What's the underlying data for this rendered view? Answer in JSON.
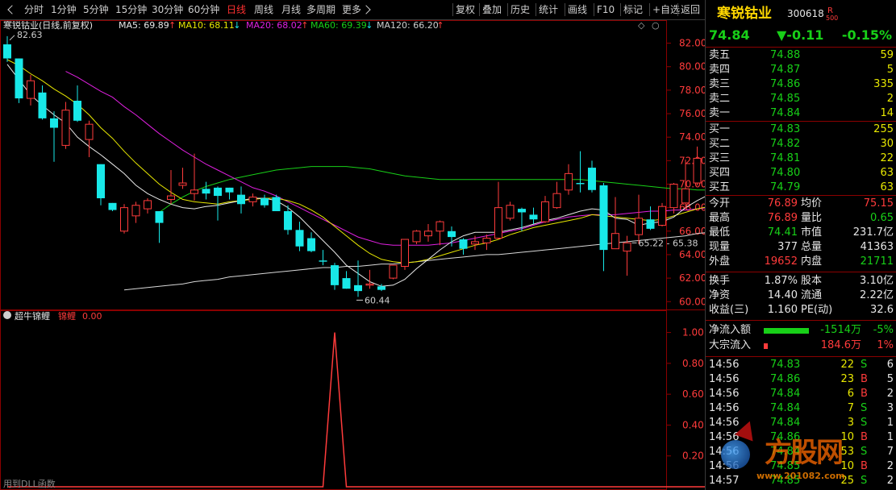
{
  "toolbar": {
    "left": [
      "分时",
      "1分钟",
      "5分钟",
      "15分钟",
      "30分钟",
      "60分钟",
      "日线",
      "周线",
      "月线",
      "多周期",
      "更多"
    ],
    "active": "日线",
    "right": [
      "复权",
      "叠加",
      "历史",
      "统计",
      "画线",
      "F10",
      "标记",
      "+自选",
      "返回"
    ]
  },
  "main": {
    "title": "寒锐钴业(日线,前复权)",
    "ma": [
      {
        "label": "MA5: 69.89",
        "arrow": "↑",
        "arrow_color": "#ff3b3b",
        "color": "#e8e8e8"
      },
      {
        "label": "MA10: 68.11",
        "arrow": "↓",
        "arrow_color": "#18e8e8",
        "color": "#e8e800"
      },
      {
        "label": "MA20: 68.02",
        "arrow": "↑",
        "arrow_color": "#ff3b3b",
        "color": "#e020e0"
      },
      {
        "label": "MA60: 69.39",
        "arrow": "↓",
        "arrow_color": "#18e8e8",
        "color": "#18d018"
      },
      {
        "label": "MA120: 66.20",
        "arrow": "↑",
        "arrow_color": "#ff3b3b",
        "color": "#cfcfcf"
      }
    ],
    "high_note": "82.63",
    "low_note": "60.44",
    "range_note": "65.22 - 65.38",
    "controls": [
      "◇",
      "○"
    ]
  },
  "sub": {
    "title": "超牛锦鲤",
    "series_label": "锦鲤",
    "value": "0.00",
    "footer": "用到DLL函数"
  },
  "chart_data": {
    "type": "candlestick",
    "ylim": [
      59.4,
      83.0
    ],
    "yticks": [
      "82.00",
      "80.00",
      "78.00",
      "76.00",
      "74.00",
      "72.00",
      "70.00",
      "68.00",
      "66.00",
      "64.00",
      "62.00",
      "60.00"
    ],
    "candles": [
      [
        81.9,
        82.6,
        80.4,
        80.7
      ],
      [
        80.7,
        80.7,
        76.9,
        77.3
      ],
      [
        77.3,
        79.3,
        76.7,
        78.8
      ],
      [
        77.8,
        78.4,
        75.5,
        75.6
      ],
      [
        75.6,
        76.2,
        71.9,
        74.8
      ],
      [
        73.3,
        77.0,
        73.0,
        76.3
      ],
      [
        77.1,
        78.4,
        75.3,
        75.4
      ],
      [
        73.8,
        75.4,
        72.3,
        75.1
      ],
      [
        71.7,
        71.7,
        68.2,
        68.8
      ],
      [
        68.4,
        68.4,
        67.7,
        67.8
      ],
      [
        66.0,
        68.3,
        65.8,
        68.0
      ],
      [
        67.3,
        68.5,
        66.7,
        68.2
      ],
      [
        67.9,
        68.8,
        67.5,
        68.6
      ],
      [
        67.7,
        67.7,
        65.0,
        66.7
      ],
      [
        68.7,
        71.2,
        68.3,
        69.0
      ],
      [
        69.9,
        71.4,
        69.6,
        70.1
      ],
      [
        69.2,
        72.6,
        68.6,
        69.5
      ],
      [
        69.6,
        70.2,
        68.7,
        69.2
      ],
      [
        69.7,
        69.8,
        66.9,
        69.0
      ],
      [
        69.7,
        69.7,
        68.7,
        69.3
      ],
      [
        69.1,
        69.8,
        67.5,
        68.3
      ],
      [
        68.5,
        69.2,
        68.1,
        68.9
      ],
      [
        68.8,
        69.1,
        68.0,
        68.2
      ],
      [
        68.9,
        69.1,
        67.7,
        67.7
      ],
      [
        67.7,
        68.2,
        65.7,
        66.1
      ],
      [
        66.1,
        66.8,
        64.3,
        64.7
      ],
      [
        65.4,
        65.9,
        64.2,
        64.3
      ],
      [
        63.5,
        64.4,
        63.1,
        63.4
      ],
      [
        63.1,
        63.3,
        61.0,
        61.4
      ],
      [
        62.0,
        62.6,
        61.1,
        61.1
      ],
      [
        61.4,
        63.5,
        60.4,
        60.9
      ],
      [
        61.4,
        62.7,
        61.1,
        61.5
      ],
      [
        61.3,
        61.5,
        60.9,
        61.0
      ],
      [
        62.0,
        63.1,
        61.9,
        63.1
      ],
      [
        63.0,
        65.3,
        62.7,
        65.3
      ],
      [
        65.1,
        66.1,
        64.9,
        66.0
      ],
      [
        65.6,
        66.6,
        65.1,
        66.0
      ],
      [
        66.0,
        66.9,
        64.8,
        66.8
      ],
      [
        66.0,
        66.4,
        64.7,
        65.5
      ],
      [
        65.3,
        65.4,
        64.0,
        64.5
      ],
      [
        64.9,
        65.6,
        64.4,
        65.1
      ],
      [
        65.0,
        65.7,
        64.4,
        65.4
      ],
      [
        65.4,
        70.2,
        65.3,
        68.0
      ],
      [
        67.1,
        68.5,
        66.9,
        68.2
      ],
      [
        67.9,
        68.0,
        66.0,
        67.6
      ],
      [
        67.4,
        68.0,
        66.6,
        67.0
      ],
      [
        66.8,
        69.0,
        66.7,
        68.5
      ],
      [
        68.0,
        70.2,
        67.9,
        69.2
      ],
      [
        69.5,
        71.7,
        69.1,
        70.9
      ],
      [
        70.1,
        72.8,
        69.3,
        70.0
      ],
      [
        71.4,
        72.0,
        69.3,
        69.5
      ],
      [
        69.9,
        70.1,
        62.6,
        64.4
      ],
      [
        64.5,
        68.9,
        65.4,
        65.8
      ],
      [
        64.3,
        65.6,
        62.2,
        65.0
      ],
      [
        65.7,
        69.1,
        64.9,
        67.1
      ],
      [
        67.0,
        68.1,
        66.1,
        66.2
      ],
      [
        66.5,
        68.4,
        66.4,
        68.1
      ],
      [
        68.0,
        70.1,
        67.5,
        70.0
      ],
      [
        68.4,
        72.1,
        67.9,
        69.6
      ],
      [
        70.1,
        73.2,
        69.9,
        72.2
      ],
      [
        71.1,
        71.7,
        68.2,
        69.5
      ],
      [
        69.8,
        71.5,
        68.3,
        71.2
      ],
      [
        69.5,
        70.2,
        67.9,
        68.1
      ],
      [
        68.2,
        72.3,
        67.9,
        70.5
      ]
    ],
    "ma5": [
      80.2,
      78.9,
      77.6,
      76.7,
      75.9,
      75.2,
      74.0,
      73.2,
      72.5,
      71.7,
      70.9,
      69.9,
      69.2,
      68.7,
      68.3,
      68.0,
      67.9,
      68.1,
      68.2,
      68.4,
      68.6,
      68.8,
      68.8,
      68.6,
      68.0,
      67.2,
      66.2,
      65.2,
      64.2,
      63.1,
      62.4,
      61.7,
      61.3,
      61.4,
      61.9,
      62.8,
      63.6,
      64.4,
      65.1,
      65.6,
      65.9,
      65.9,
      65.9,
      66.1,
      66.3,
      66.6,
      66.9,
      67.1,
      67.4,
      67.7,
      67.9,
      67.8,
      67.1,
      67.0,
      66.5,
      66.7,
      66.8,
      67.2,
      68.0,
      68.6,
      69.1,
      69.3,
      69.6,
      69.9
    ],
    "ma10": [
      80.6,
      80.1,
      79.4,
      78.8,
      78.1,
      77.5,
      76.8,
      75.9,
      74.8,
      73.9,
      72.8,
      71.8,
      70.9,
      70.0,
      69.3,
      68.7,
      68.5,
      68.4,
      68.3,
      68.5,
      68.6,
      68.7,
      68.8,
      68.8,
      68.6,
      68.3,
      67.8,
      67.2,
      66.4,
      65.6,
      64.8,
      64.1,
      63.6,
      63.4,
      63.3,
      63.4,
      63.6,
      63.9,
      64.2,
      64.5,
      64.8,
      65.0,
      65.3,
      65.7,
      66.0,
      66.3,
      66.5,
      66.7,
      66.9,
      67.1,
      67.4,
      67.3,
      67.2,
      67.1,
      67.0,
      66.9,
      67.0,
      67.3,
      67.6,
      67.9,
      68.1,
      68.3,
      68.1,
      68.1
    ],
    "ma20": [
      null,
      null,
      null,
      null,
      null,
      79.6,
      79.1,
      78.5,
      77.9,
      77.4,
      76.6,
      75.9,
      75.1,
      74.3,
      73.6,
      72.9,
      72.3,
      71.7,
      71.2,
      70.7,
      70.2,
      69.7,
      69.4,
      69.0,
      68.5,
      68.0,
      67.5,
      67.0,
      66.5,
      66.0,
      65.5,
      65.2,
      64.9,
      64.8,
      64.8,
      64.8,
      64.8,
      64.9,
      65.0,
      65.2,
      65.4,
      65.6,
      65.8,
      66.0,
      66.2,
      66.5,
      66.8,
      67.0,
      67.2,
      67.3,
      67.4,
      67.4,
      67.4,
      67.5,
      67.6,
      67.7,
      67.7,
      67.8,
      67.8,
      67.9,
      68.0,
      68.0,
      68.0,
      68.02
    ],
    "ma60": [
      null,
      null,
      null,
      null,
      null,
      null,
      null,
      null,
      null,
      null,
      null,
      null,
      null,
      67.6,
      68.3,
      68.9,
      69.4,
      69.8,
      70.1,
      70.4,
      70.6,
      70.8,
      71.0,
      71.2,
      71.3,
      71.4,
      71.5,
      71.5,
      71.5,
      71.5,
      71.4,
      71.3,
      71.1,
      70.9,
      70.7,
      70.6,
      70.5,
      70.4,
      70.4,
      70.4,
      70.4,
      70.4,
      70.4,
      70.4,
      70.4,
      70.4,
      70.4,
      70.4,
      70.4,
      70.4,
      70.3,
      70.2,
      70.1,
      70.0,
      69.9,
      69.8,
      69.7,
      69.6,
      69.6,
      69.5,
      69.5,
      69.4,
      69.4,
      69.39
    ],
    "ma120": [
      null,
      null,
      null,
      null,
      null,
      null,
      null,
      null,
      null,
      null,
      61.0,
      61.1,
      61.2,
      61.3,
      61.4,
      61.5,
      61.7,
      61.8,
      61.9,
      62.1,
      62.2,
      62.3,
      62.4,
      62.5,
      62.6,
      62.7,
      62.8,
      62.9,
      62.9,
      63.0,
      63.0,
      63.1,
      63.2,
      63.2,
      63.3,
      63.4,
      63.5,
      63.6,
      63.7,
      63.8,
      63.9,
      64.0,
      64.0,
      64.1,
      64.2,
      64.3,
      64.4,
      64.5,
      64.6,
      64.7,
      64.8,
      64.9,
      65.0,
      65.1,
      65.2,
      65.3,
      65.4,
      65.5,
      65.6,
      65.8,
      65.9,
      66.0,
      66.1,
      66.2
    ],
    "sub": {
      "ylim": [
        0,
        1.05
      ],
      "yticks": [
        "1.00",
        "0.80",
        "0.60",
        "0.40",
        "0.20"
      ],
      "values": [
        0,
        0,
        0,
        0,
        0,
        0,
        0,
        0,
        0,
        0,
        0,
        0,
        0,
        0,
        0,
        0,
        0,
        0,
        0,
        0,
        0,
        0,
        0,
        0,
        0,
        0,
        0,
        0,
        1,
        0,
        0,
        0,
        0,
        0,
        0,
        0,
        0,
        0,
        0,
        0,
        0,
        0,
        0,
        0,
        0,
        0,
        0,
        0,
        0,
        0,
        0,
        0,
        0,
        0,
        0,
        0,
        0,
        0,
        0,
        0,
        0,
        0,
        0,
        0
      ]
    }
  },
  "panel": {
    "name": "寒锐钴业",
    "code": "300618",
    "code_tag_r": "R",
    "code_tag_num": "500",
    "price": "74.84",
    "change": "▼-0.11",
    "change_pct": "-0.15%",
    "asks": [
      {
        "label": "卖五",
        "price": "74.88",
        "vol": "59"
      },
      {
        "label": "卖四",
        "price": "74.87",
        "vol": "5"
      },
      {
        "label": "卖三",
        "price": "74.86",
        "vol": "335"
      },
      {
        "label": "卖二",
        "price": "74.85",
        "vol": "2"
      },
      {
        "label": "卖一",
        "price": "74.84",
        "vol": "14"
      }
    ],
    "bids": [
      {
        "label": "买一",
        "price": "74.83",
        "vol": "255"
      },
      {
        "label": "买二",
        "price": "74.82",
        "vol": "30"
      },
      {
        "label": "买三",
        "price": "74.81",
        "vol": "22"
      },
      {
        "label": "买四",
        "price": "74.80",
        "vol": "63"
      },
      {
        "label": "买五",
        "price": "74.79",
        "vol": "63"
      }
    ],
    "stats": [
      {
        "k1": "今开",
        "v1": "76.89",
        "c1": "r",
        "k2": "均价",
        "v2": "75.15",
        "c2": "r"
      },
      {
        "k1": "最高",
        "v1": "76.89",
        "c1": "r",
        "k2": "量比",
        "v2": "0.65",
        "c2": "g"
      },
      {
        "k1": "最低",
        "v1": "74.41",
        "c1": "g",
        "k2": "市值",
        "v2": "231.7亿",
        "c2": "w"
      },
      {
        "k1": "现量",
        "v1": "377",
        "c1": "w",
        "k2": "总量",
        "v2": "41363",
        "c2": "w"
      },
      {
        "k1": "外盘",
        "v1": "19652",
        "c1": "r",
        "k2": "内盘",
        "v2": "21711",
        "c2": "g"
      }
    ],
    "stats2": [
      {
        "k1": "换手",
        "v1": "1.87%",
        "k2": "股本",
        "v2": "3.10亿"
      },
      {
        "k1": "净资",
        "v1": "14.40",
        "k2": "流通",
        "v2": "2.22亿"
      },
      {
        "k1": "收益(三)",
        "v1": "1.160",
        "k2": "PE(动)",
        "v2": "32.6"
      }
    ],
    "flow": [
      {
        "label": "净流入额",
        "value": "-1514万",
        "pct": "-5%",
        "bar": "#18d018",
        "fill": 0.7,
        "vc": "g"
      },
      {
        "label": "大宗流入",
        "value": "184.6万",
        "pct": "1%",
        "bar": "#ff3b3b",
        "fill": 0.04,
        "vc": "r"
      }
    ],
    "ticks": [
      {
        "t": "14:56",
        "p": "74.83",
        "v": "22",
        "s": "S",
        "n": "6"
      },
      {
        "t": "14:56",
        "p": "74.86",
        "v": "23",
        "s": "B",
        "n": "5"
      },
      {
        "t": "14:56",
        "p": "74.84",
        "v": "6",
        "s": "B",
        "n": "2"
      },
      {
        "t": "14:56",
        "p": "74.84",
        "v": "7",
        "s": "S",
        "n": "3"
      },
      {
        "t": "14:56",
        "p": "74.84",
        "v": "3",
        "s": "S",
        "n": "1"
      },
      {
        "t": "14:56",
        "p": "74.86",
        "v": "10",
        "s": "B",
        "n": "1"
      },
      {
        "t": "14:56",
        "p": "74.84",
        "v": "53",
        "s": "S",
        "n": "7"
      },
      {
        "t": "14:56",
        "p": "74.85",
        "v": "10",
        "s": "B",
        "n": "2"
      },
      {
        "t": "14:57",
        "p": "74.85",
        "v": "25",
        "s": "S",
        "n": "2"
      }
    ],
    "watermark": {
      "brand": "方股网",
      "url": "www.201082.com"
    }
  }
}
